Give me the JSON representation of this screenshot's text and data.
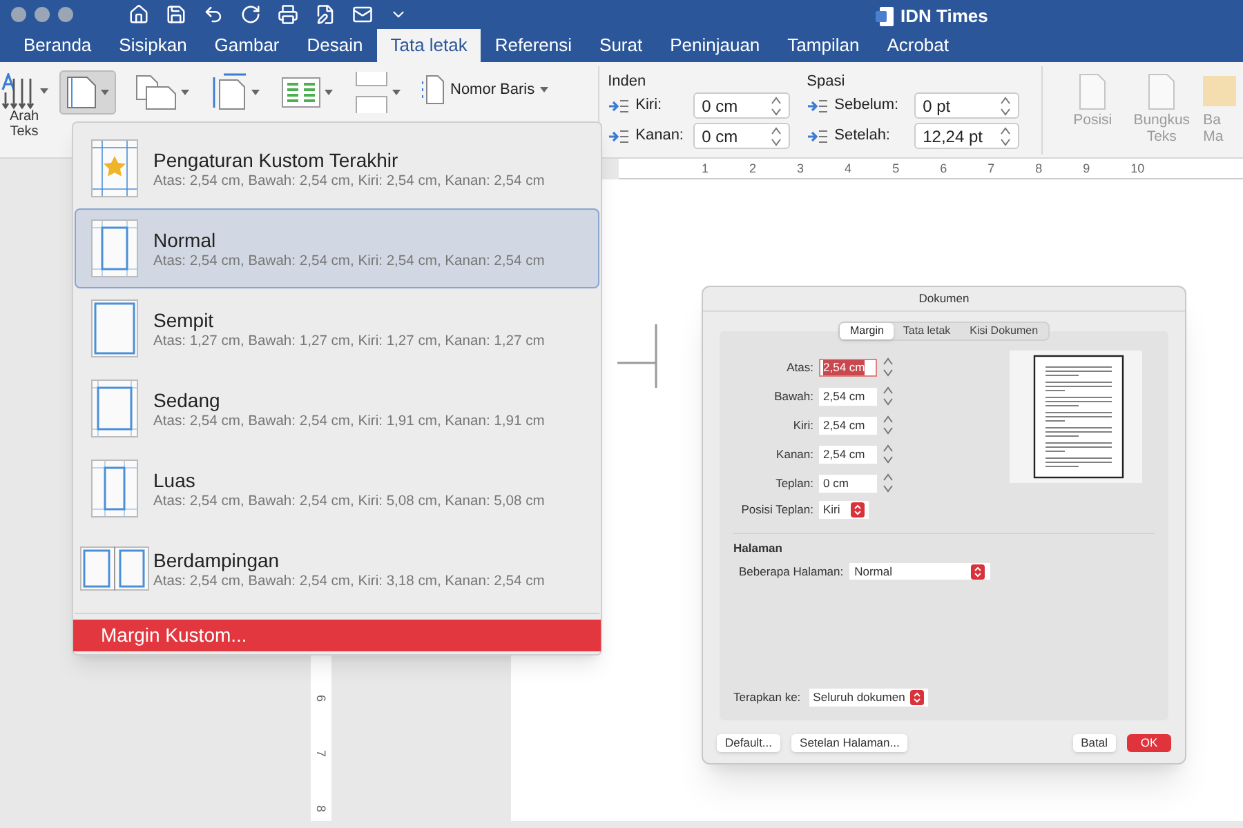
{
  "window": {
    "title": "IDN Times"
  },
  "tabs": [
    {
      "label": "Beranda",
      "selected": false
    },
    {
      "label": "Sisipkan",
      "selected": false
    },
    {
      "label": "Gambar",
      "selected": false
    },
    {
      "label": "Desain",
      "selected": false
    },
    {
      "label": "Tata letak",
      "selected": true
    },
    {
      "label": "Referensi",
      "selected": false
    },
    {
      "label": "Surat",
      "selected": false
    },
    {
      "label": "Peninjauan",
      "selected": false
    },
    {
      "label": "Tampilan",
      "selected": false
    },
    {
      "label": "Acrobat",
      "selected": false
    }
  ],
  "ribbon": {
    "text_direction": {
      "lines": [
        "Arah",
        "Teks"
      ]
    },
    "line_numbers": {
      "label": "Nomor Baris"
    },
    "indent": {
      "title": "Inden",
      "fields": [
        {
          "label": "Kiri:",
          "value": "0 cm"
        },
        {
          "label": "Kanan:",
          "value": "0 cm"
        }
      ]
    },
    "spacing": {
      "title": "Spasi",
      "fields": [
        {
          "label": "Sebelum:",
          "value": "0 pt"
        },
        {
          "label": "Setelah:",
          "value": "12,24 pt"
        }
      ]
    },
    "arrange": [
      {
        "lines": [
          "Posisi"
        ]
      },
      {
        "lines": [
          "Bungkus",
          "Teks"
        ]
      },
      {
        "lines": [
          "Ba",
          "Ma"
        ]
      }
    ]
  },
  "ruler": {
    "numbers": [
      "1",
      "2",
      "3",
      "4",
      "5",
      "6",
      "7",
      "8",
      "9",
      "10"
    ]
  },
  "vertical_ruler": {
    "numbers": [
      "6",
      "7",
      "8"
    ]
  },
  "margin_menu": {
    "items": [
      {
        "kind": "custom",
        "name": "Pengaturan Kustom Terakhir",
        "detail": "Atas: 2,54 cm, Bawah: 2,54 cm, Kiri: 2,54 cm, Kanan: 2,54 cm",
        "selected": false
      },
      {
        "kind": "normal",
        "name": "Normal",
        "detail": "Atas: 2,54 cm, Bawah: 2,54 cm, Kiri: 2,54 cm, Kanan: 2,54 cm",
        "selected": true
      },
      {
        "kind": "narrow",
        "name": "Sempit",
        "detail": "Atas: 1,27 cm, Bawah: 1,27 cm, Kiri: 1,27 cm, Kanan: 1,27 cm",
        "selected": false
      },
      {
        "kind": "moderate",
        "name": "Sedang",
        "detail": "Atas: 2,54 cm, Bawah: 2,54 cm, Kiri: 1,91 cm, Kanan: 1,91 cm",
        "selected": false
      },
      {
        "kind": "wide",
        "name": "Luas",
        "detail": "Atas: 2,54 cm, Bawah: 2,54 cm, Kiri: 5,08 cm, Kanan: 5,08 cm",
        "selected": false
      },
      {
        "kind": "mirrored",
        "name": "Berdampingan",
        "detail": "Atas: 2,54 cm, Bawah: 2,54 cm, Kiri: 3,18 cm, Kanan: 2,54 cm",
        "selected": false
      }
    ],
    "custom": "Margin Kustom..."
  },
  "dialog": {
    "title": "Dokumen",
    "tabs": [
      {
        "label": "Margin",
        "selected": true
      },
      {
        "label": "Tata letak",
        "selected": false
      },
      {
        "label": "Kisi Dokumen",
        "selected": false
      }
    ],
    "fields": [
      {
        "label": "Atas:",
        "value": "2,54 cm",
        "focused": true
      },
      {
        "label": "Bawah:",
        "value": "2,54 cm",
        "focused": false
      },
      {
        "label": "Kiri:",
        "value": "2,54 cm",
        "focused": false
      },
      {
        "label": "Kanan:",
        "value": "2,54 cm",
        "focused": false
      },
      {
        "label": "Teplan:",
        "value": "0 cm",
        "focused": false
      }
    ],
    "gutter_position": {
      "label": "Posisi Teplan:",
      "value": "Kiri"
    },
    "pages": {
      "heading": "Halaman",
      "label": "Beberapa Halaman:",
      "value": "Normal"
    },
    "apply_to": {
      "label": "Terapkan ke:",
      "value": "Seluruh dokumen"
    },
    "buttons": [
      {
        "label": "Default...",
        "primary": false
      },
      {
        "label": "Setelan Halaman...",
        "primary": false
      },
      {
        "label": "Batal",
        "primary": false
      },
      {
        "label": "OK",
        "primary": true
      }
    ]
  }
}
